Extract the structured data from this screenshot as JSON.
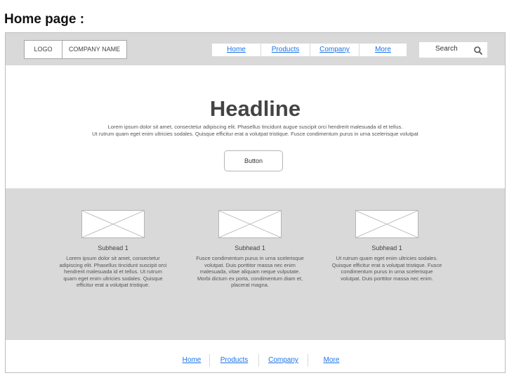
{
  "page_heading": "Home page :",
  "navbar": {
    "logo": "LOGO",
    "company_name": "COMPANY NAME",
    "links": [
      "Home",
      "Products",
      "Company",
      "More"
    ],
    "search": {
      "label": "Search",
      "icon": "search-icon"
    }
  },
  "hero": {
    "headline": "Headline",
    "text_line1": "Lorem ipsum dolor sit amet, consectetur adipiscing elit. Phasellus tincidunt augue suscipit orci hendrerit malesuada id et tellus.",
    "text_line2": "Ut rutrum quam eget enim ultricies sodales. Quisque efficitur erat a volutpat tristique. Fusce condimentum purus in urna scelerisque volutpat",
    "button_label": "Button"
  },
  "features": [
    {
      "image": "image-placeholder-icon",
      "subhead": "Subhead 1",
      "body": "Lorem ipsum dolor sit amet, consectetur adipiscing elit. Phasellus tincidunt suscipit orci hendrerit malesuada id et tellus. Ut rutrum quam eget enim ultricies sodales. Quisque efficitur erat a volutpat tristique."
    },
    {
      "image": "image-placeholder-icon",
      "subhead": "Subhead 1",
      "body": "Fusce condimentum purus in urna scelerisque volutpat. Duis porttitor massa nec enim malesuada, vitae aliquam neque vulputate. Morbi dictum ex porta, condimentum diam et, placerat magna."
    },
    {
      "image": "image-placeholder-icon",
      "subhead": "Subhead 1",
      "body": "Ut rutrum quam eget enim ultricies sodales. Quisque efficitur erat a volutpat tristique. Fusce condimentum purus in urna scelerisque volutpat. Duis porttitor massa nec enim."
    }
  ],
  "footer": {
    "links": [
      "Home",
      "Products",
      "Company",
      "More"
    ]
  },
  "colors": {
    "band_gray": "#d9d9d9",
    "link_blue": "#1a73e8"
  }
}
